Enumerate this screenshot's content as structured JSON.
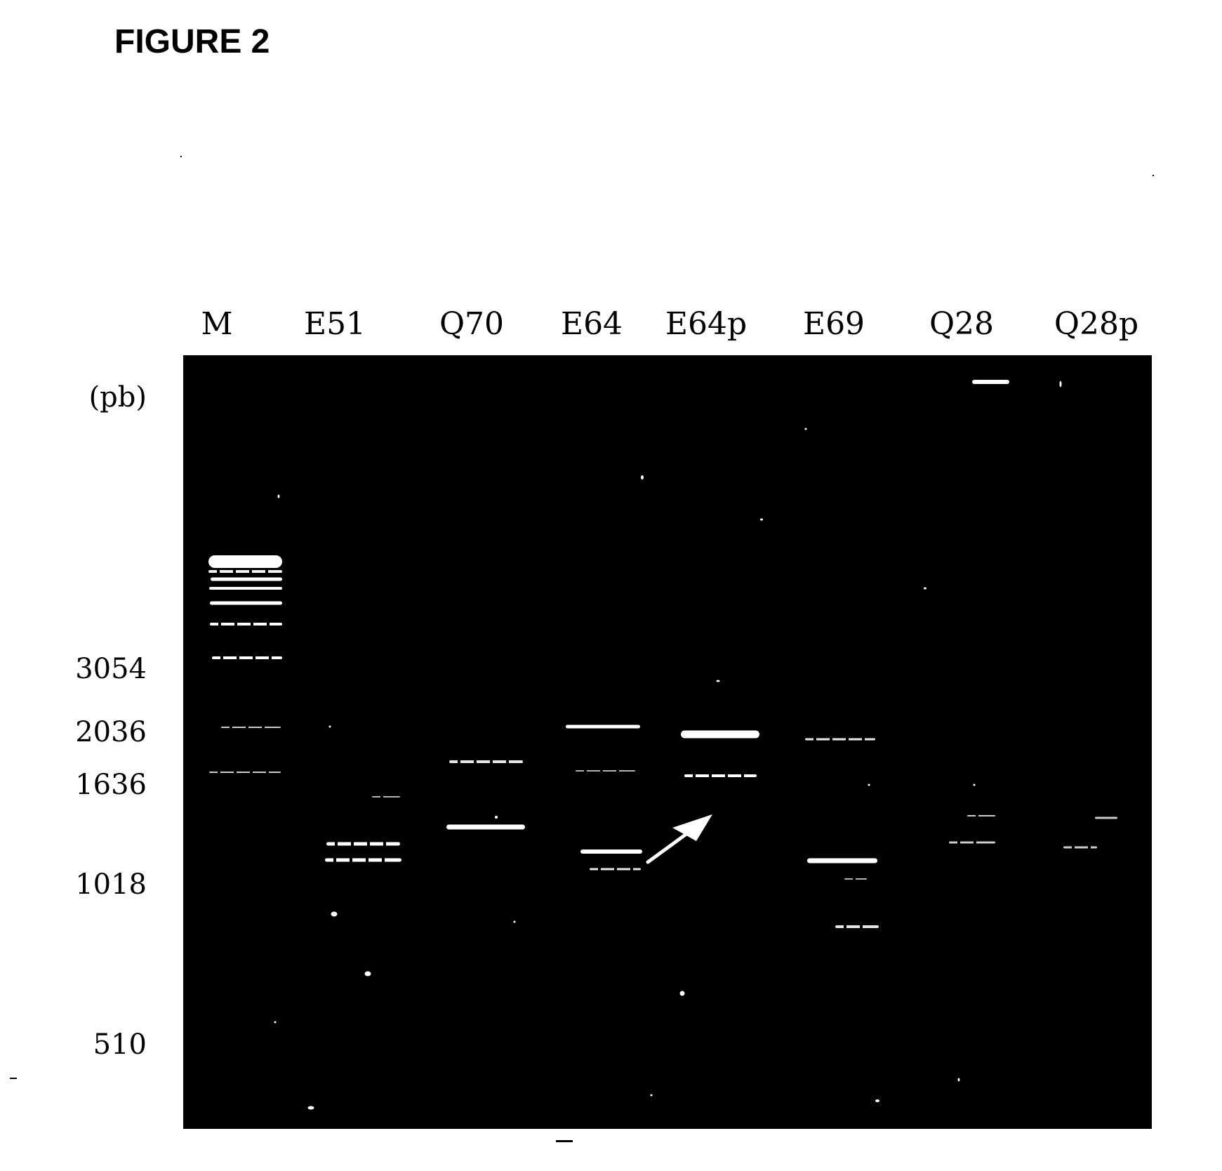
{
  "figure": {
    "title": "FIGURE 2",
    "unit_label": "(pb)"
  },
  "chart_data": {
    "type": "gel-electrophoresis",
    "title": "FIGURE 2",
    "ylabel": "(pb)",
    "lanes": [
      "M",
      "E51",
      "Q70",
      "E64",
      "E64p",
      "E69",
      "Q28",
      "Q28p"
    ],
    "size_markers_bp": [
      3054,
      2036,
      1636,
      1018,
      510
    ],
    "bands": [
      {
        "lane": "M",
        "approx_bp": ">3054",
        "count": 7,
        "intensity": "strong"
      },
      {
        "lane": "M",
        "approx_bp": 3054,
        "intensity": "strong"
      },
      {
        "lane": "M",
        "approx_bp": 2036,
        "intensity": "faint"
      },
      {
        "lane": "M",
        "approx_bp": 1636,
        "intensity": "faint"
      },
      {
        "lane": "E51",
        "approx_bp": 1500,
        "intensity": "faint"
      },
      {
        "lane": "E51",
        "approx_bp": 1200,
        "intensity": "strong"
      },
      {
        "lane": "E51",
        "approx_bp": 1150,
        "intensity": "strong"
      },
      {
        "lane": "Q70",
        "approx_bp": 1750,
        "intensity": "medium"
      },
      {
        "lane": "Q70",
        "approx_bp": 1350,
        "intensity": "strong"
      },
      {
        "lane": "E64",
        "approx_bp": 2036,
        "intensity": "strong"
      },
      {
        "lane": "E64",
        "approx_bp": 1636,
        "intensity": "faint"
      },
      {
        "lane": "E64",
        "approx_bp": 1180,
        "intensity": "strong"
      },
      {
        "lane": "E64",
        "approx_bp": 1120,
        "intensity": "medium"
      },
      {
        "lane": "E64p",
        "approx_bp": 2000,
        "intensity": "strong"
      },
      {
        "lane": "E64p",
        "approx_bp": 1636,
        "intensity": "medium"
      },
      {
        "lane": "E69",
        "approx_bp": 1950,
        "intensity": "medium"
      },
      {
        "lane": "E69",
        "approx_bp": 1150,
        "intensity": "strong"
      },
      {
        "lane": "E69",
        "approx_bp": 880,
        "intensity": "medium"
      },
      {
        "lane": "Q28",
        "approx_bp": ">10000",
        "intensity": "strong"
      },
      {
        "lane": "Q28",
        "approx_bp": 1400,
        "intensity": "faint"
      },
      {
        "lane": "Q28",
        "approx_bp": 1250,
        "intensity": "faint"
      },
      {
        "lane": "Q28p",
        "approx_bp": 1400,
        "intensity": "faint"
      },
      {
        "lane": "Q28p",
        "approx_bp": 1230,
        "intensity": "faint"
      }
    ],
    "annotations": [
      {
        "type": "arrow",
        "points_to": "E64p band near 1636 bp"
      }
    ]
  }
}
